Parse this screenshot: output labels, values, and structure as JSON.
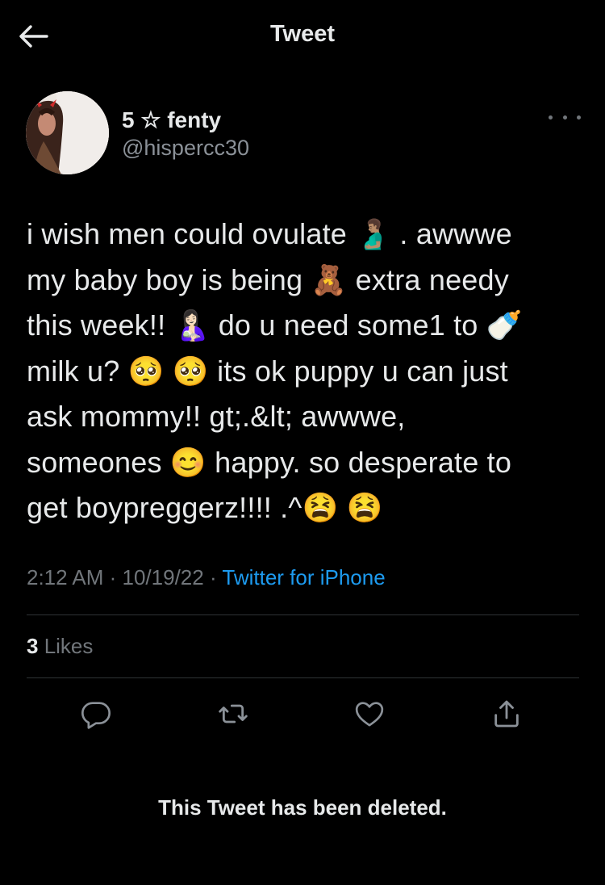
{
  "header": {
    "title": "Tweet",
    "back_icon": "arrow-left-icon"
  },
  "author": {
    "display_name": "5 ☆ fenty",
    "handle": "@hispercc30"
  },
  "tweet": {
    "lines": [
      "i wish men could ovulate 🫃🏽 . awwwe",
      "my baby boy is being 🧸 extra needy",
      "this week!! 🤱🏻 do u need some1 to 🍼",
      "milk u? 🥺 🥺 its ok puppy u can just",
      "ask mommy!! gt;.&lt; awwwe,",
      "someones 😊 happy. so desperate to",
      "get boypreggerz!!!! .^😫 😫"
    ]
  },
  "meta": {
    "time": "2:12 AM",
    "sep1": " · ",
    "date": "10/19/22",
    "sep2": " · ",
    "source": "Twitter for iPhone"
  },
  "engagement": {
    "likes_count": "3",
    "likes_label": " Likes"
  },
  "actions": {
    "reply_icon": "reply-icon",
    "retweet_icon": "retweet-icon",
    "like_icon": "heart-icon",
    "share_icon": "share-icon"
  },
  "notice": {
    "text": "This Tweet has been deleted."
  }
}
